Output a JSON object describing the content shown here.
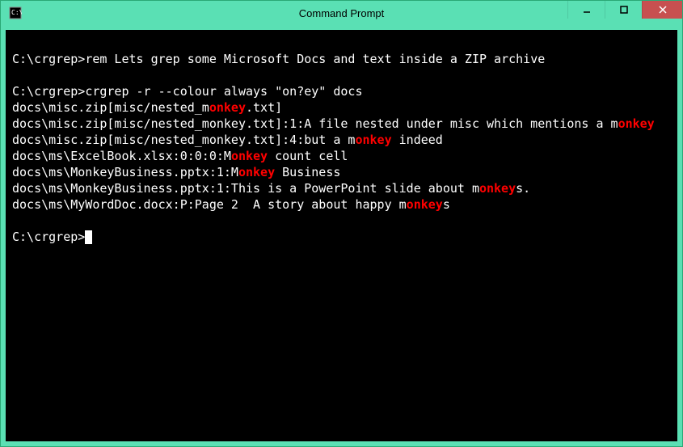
{
  "window": {
    "title": "Command Prompt"
  },
  "terminal": {
    "prompt_path": "C:\\crgrep>",
    "cmd1": "rem Lets grep some Microsoft Docs and text inside a ZIP archive",
    "cmd2": "crgrep -r --colour always \"on?ey\" docs",
    "l1_pre": "docs\\misc.zip[misc/nested_m",
    "l1_hl": "onkey",
    "l1_post": ".txt]",
    "l2_pre": "docs\\misc.zip[misc/nested_monkey.txt]:1:A file nested under misc which mentions a m",
    "l2_hl": "onkey",
    "l3_pre": "docs\\misc.zip[misc/nested_monkey.txt]:4:but a m",
    "l3_hl": "onkey",
    "l3_post": " indeed",
    "l4_pre": "docs\\ms\\ExcelBook.xlsx:0:0:0:M",
    "l4_hl": "onkey",
    "l4_post": " count cell",
    "l5_pre": "docs\\ms\\MonkeyBusiness.pptx:1:M",
    "l5_hl": "onkey",
    "l5_post": " Business",
    "l6_pre": "docs\\ms\\MonkeyBusiness.pptx:1:This is a PowerPoint slide about m",
    "l6_hl": "onkey",
    "l6_post": "s.",
    "l7_pre": "docs\\ms\\MyWordDoc.docx:P:Page 2  A story about happy m",
    "l7_hl": "onkey",
    "l7_post": "s"
  }
}
